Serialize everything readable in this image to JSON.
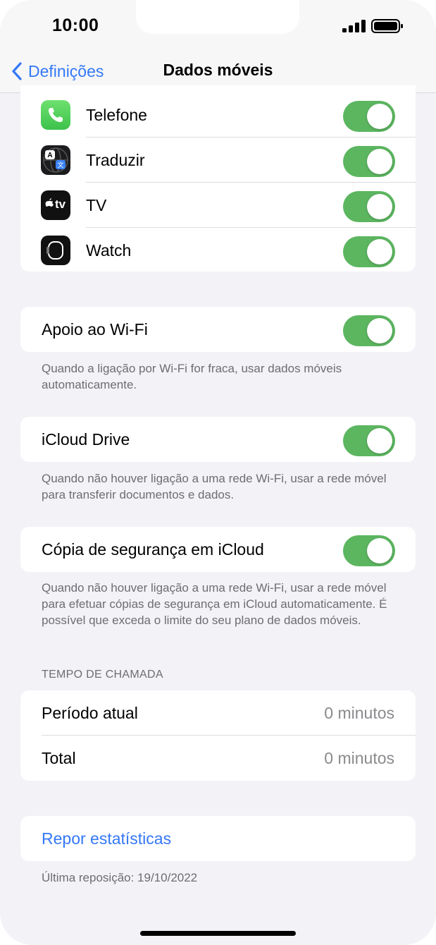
{
  "status_bar": {
    "time": "10:00"
  },
  "nav": {
    "back_label": "Definições",
    "title": "Dados móveis"
  },
  "apps": [
    {
      "label": "Telefone",
      "icon": "phone-icon",
      "enabled": true
    },
    {
      "label": "Traduzir",
      "icon": "translate-icon",
      "enabled": true
    },
    {
      "label": "TV",
      "icon": "apple-tv-icon",
      "enabled": true,
      "icon_text": "tv"
    },
    {
      "label": "Watch",
      "icon": "watch-icon",
      "enabled": true
    }
  ],
  "wifi_assist": {
    "label": "Apoio ao Wi-Fi",
    "enabled": true,
    "footer": "Quando a ligação por Wi-Fi for fraca, usar dados móveis automaticamente."
  },
  "icloud_drive": {
    "label": "iCloud Drive",
    "enabled": true,
    "footer": "Quando não houver ligação a uma rede Wi-Fi, usar a rede móvel para transferir documentos e dados."
  },
  "icloud_backup": {
    "label": "Cópia de segurança em iCloud",
    "enabled": true,
    "footer": "Quando não houver ligação a uma rede Wi-Fi, usar a rede móvel para efetuar cópias de segurança em iCloud automaticamente. É possível que exceda o limite do seu plano de dados móveis."
  },
  "call_time": {
    "header": "TEMPO DE CHAMADA",
    "rows": [
      {
        "label": "Período atual",
        "value": "0 minutos"
      },
      {
        "label": "Total",
        "value": "0 minutos"
      }
    ]
  },
  "reset": {
    "label": "Repor estatísticas",
    "last_reset": "Última reposição: 19/10/2022"
  },
  "colors": {
    "accent": "#3478f6",
    "toggle_on": "#5cb660",
    "background": "#f2f2f7"
  }
}
